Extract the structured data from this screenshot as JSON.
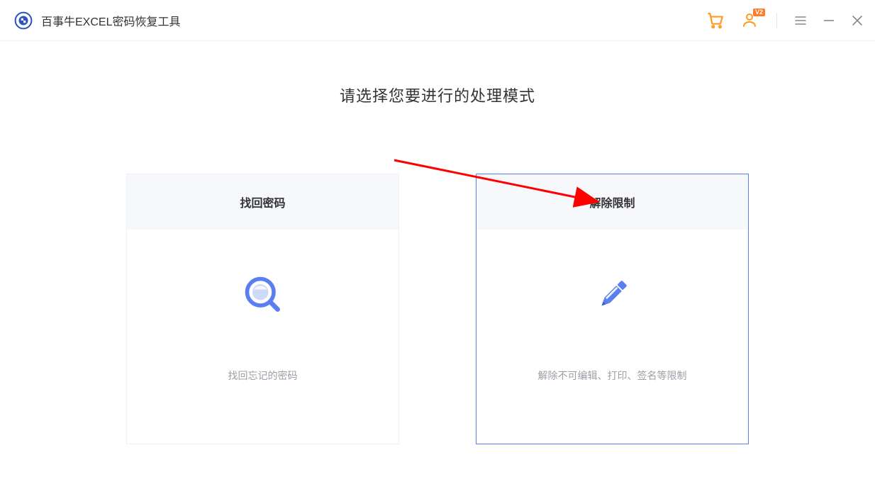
{
  "app": {
    "title": "百事牛EXCEL密码恢复工具"
  },
  "titlebar": {
    "user_badge": "V2"
  },
  "main": {
    "heading": "请选择您要进行的处理模式"
  },
  "cards": [
    {
      "id": "recover-password",
      "title": "找回密码",
      "desc": "找回忘记的密码",
      "selected": false
    },
    {
      "id": "remove-restriction",
      "title": "解除限制",
      "desc": "解除不可编辑、打印、签名等限制",
      "selected": true
    }
  ]
}
